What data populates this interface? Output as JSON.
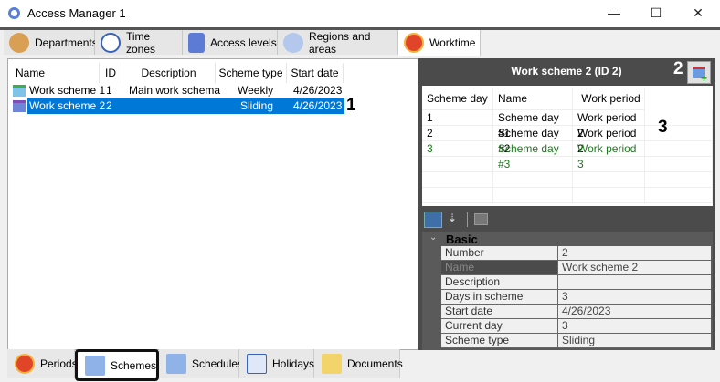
{
  "window": {
    "title": "Access Manager 1",
    "minimize": "—",
    "maximize": "☐",
    "close": "✕"
  },
  "top_tabs": [
    {
      "label": "Departments",
      "icon": "person-icon"
    },
    {
      "label": "Time zones",
      "icon": "clock-icon"
    },
    {
      "label": "Access levels",
      "icon": "lock-icon"
    },
    {
      "label": "Regions and areas",
      "icon": "pin-icon"
    },
    {
      "label": "Worktime",
      "icon": "worktime-clock-icon",
      "selected": true
    }
  ],
  "schemes_list": {
    "columns": [
      "Name",
      "ID",
      "Description",
      "Scheme type",
      "Start date"
    ],
    "rows": [
      {
        "name": "Work scheme 1",
        "id": "1",
        "description": "Main work schema",
        "type": "Weekly",
        "start": "4/26/2023"
      },
      {
        "name": "Work scheme 2",
        "id": "2",
        "description": "",
        "type": "Sliding",
        "start": "4/26/2023",
        "selected": true
      }
    ]
  },
  "details": {
    "title": "Work scheme 2 (ID 2)",
    "columns": [
      "Scheme day",
      "Name",
      "Work period"
    ],
    "rows": [
      {
        "day": "1",
        "name": "Scheme day #1",
        "period": "Work period 2"
      },
      {
        "day": "2",
        "name": "Scheme day #2",
        "period": "Work period 2"
      },
      {
        "day": "3",
        "name": "Scheme day #3",
        "period": "Work period 3",
        "highlight": "#1e7a1e"
      }
    ]
  },
  "properties": {
    "category": "Basic",
    "rows": [
      {
        "label": "Number",
        "value": "2"
      },
      {
        "label": "Name",
        "value": "Work scheme 2",
        "selected": true
      },
      {
        "label": "Description",
        "value": ""
      },
      {
        "label": "Days in scheme",
        "value": "3"
      },
      {
        "label": "Start date",
        "value": "4/26/2023"
      },
      {
        "label": "Current day",
        "value": "3"
      },
      {
        "label": "Scheme type",
        "value": "Sliding"
      }
    ]
  },
  "bottom_tabs": [
    {
      "label": "Periods"
    },
    {
      "label": "Schemes",
      "selected": true
    },
    {
      "label": "Schedules"
    },
    {
      "label": "Holidays"
    },
    {
      "label": "Documents"
    }
  ],
  "annotations": [
    "1",
    "2",
    "3"
  ]
}
